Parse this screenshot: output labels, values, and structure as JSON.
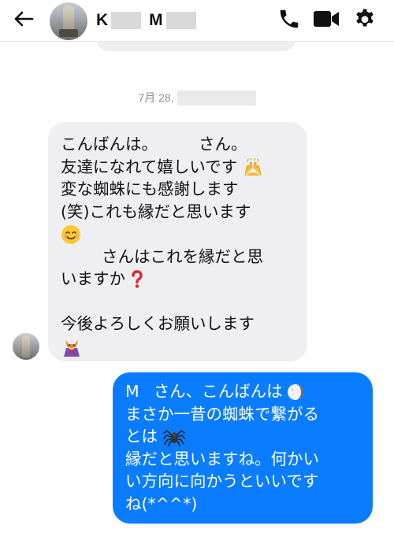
{
  "header": {
    "back_icon": "arrow-left-icon",
    "contact_initial_first": "K",
    "contact_initial_last": "M",
    "icons": [
      "phone-icon",
      "video-camera-icon",
      "gear-icon"
    ]
  },
  "conversation": {
    "timestamp_prefix": "7月 28,",
    "incoming_message": {
      "lines": [
        "こんばんは。",
        "さん。",
        "友達になれて嬉しいです",
        "変な蜘蛛にも感謝します",
        "(笑)これも縁だと思います",
        "さんはこれを縁だと思",
        "いますか",
        "今後よろしくお願いします"
      ],
      "emojis": [
        "raising-hands-icon",
        "smiling-face-icon",
        "red-question-mark-icon",
        "fox-in-cape-icon"
      ]
    },
    "outgoing_message": {
      "lines": [
        "M",
        "さん、こんばんは",
        "まさか一昔の蜘蛛で繋がる",
        "とは",
        "縁だと思いますね。何かい",
        "い方向に向かうといいです",
        "ね(*^^*)"
      ],
      "emojis": [
        "crescent-moon-icon",
        "spider-icon"
      ]
    },
    "colors": {
      "incoming_bubble": "#efeff2",
      "outgoing_bubble": "#0a7cff",
      "timestamp_text": "#8a8d91"
    }
  }
}
